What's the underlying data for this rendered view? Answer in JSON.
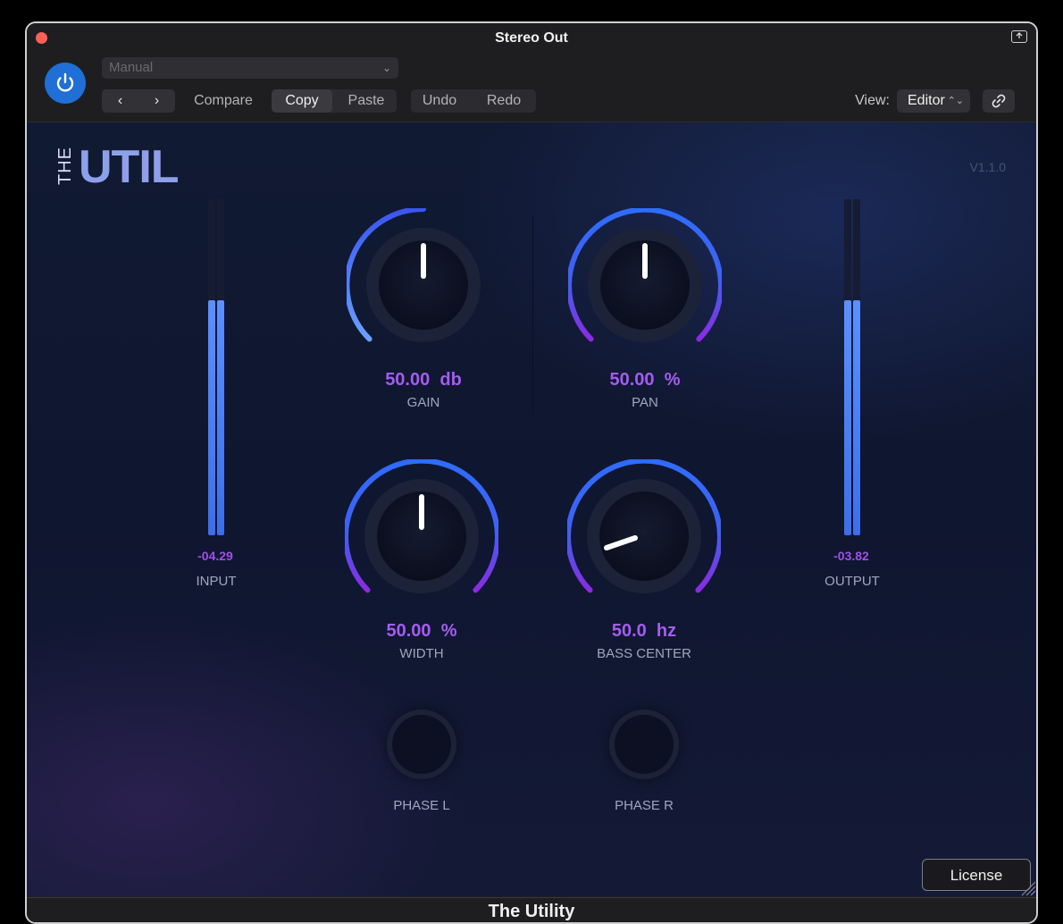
{
  "window": {
    "title": "Stereo Out",
    "footer_title": "The Utility"
  },
  "toolbar": {
    "preset": "Manual",
    "compare_label": "Compare",
    "copy_label": "Copy",
    "paste_label": "Paste",
    "undo_label": "Undo",
    "redo_label": "Redo",
    "view_label": "View:",
    "view_value": "Editor"
  },
  "plugin": {
    "logo_the": "THE",
    "logo_util": "UTIL",
    "version": "V1.1.0",
    "input": {
      "value": "-04.29",
      "label": "INPUT",
      "level_fraction": 0.7
    },
    "output": {
      "value": "-03.82",
      "label": "OUTPUT",
      "level_fraction": 0.7
    },
    "knobs": {
      "gain": {
        "value": "50.00",
        "unit": "db",
        "label": "GAIN"
      },
      "pan": {
        "value": "50.00",
        "unit": "%",
        "label": "PAN"
      },
      "width": {
        "value": "50.00",
        "unit": "%",
        "label": "WIDTH"
      },
      "bass_center": {
        "value": "50.0",
        "unit": "hz",
        "label": "BASS CENTER"
      }
    },
    "phase_l": {
      "label": "PHASE  L"
    },
    "phase_r": {
      "label": "PHASE  R"
    },
    "license_label": "License"
  },
  "colors": {
    "accent_blue": "#3d7bff",
    "accent_purple": "#8a2be2",
    "value_purple": "#a45cf0",
    "power_blue": "#1f6fd6",
    "close_red": "#fe5f57"
  },
  "icons": [
    "power-icon",
    "chevron-left-icon",
    "chevron-right-icon",
    "link-icon",
    "export-icon",
    "resize-grip-icon"
  ]
}
